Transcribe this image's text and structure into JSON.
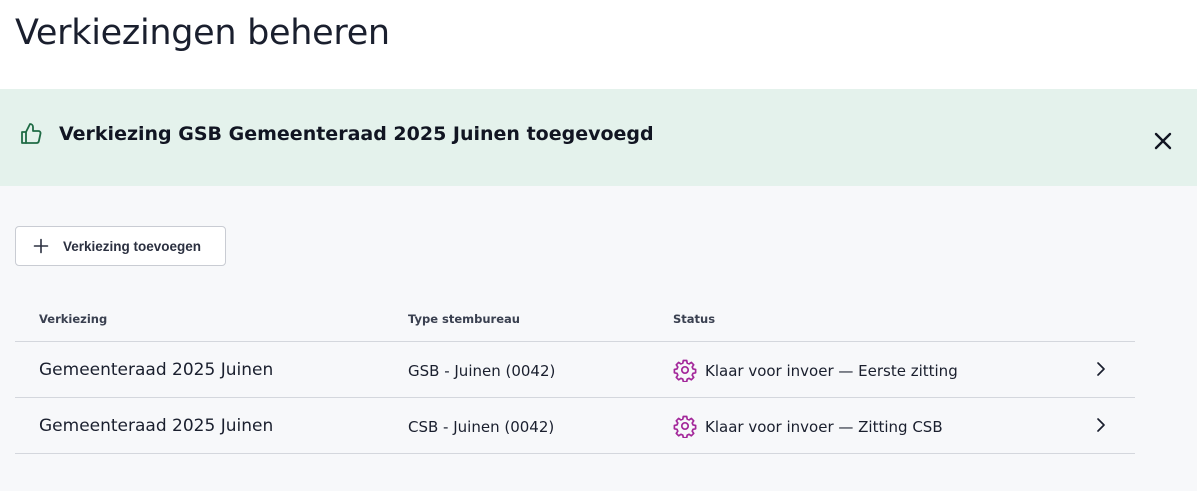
{
  "header": {
    "title": "Verkiezingen beheren"
  },
  "alert": {
    "message": "Verkiezing GSB Gemeenteraad 2025 Juinen toegevoegd",
    "icon": "thumbs-up-icon",
    "close_icon": "close-icon",
    "background_color": "#e4f2ec",
    "icon_color": "#1f6b45"
  },
  "toolbar": {
    "add_label": "Verkiezing toevoegen",
    "add_icon": "plus-icon"
  },
  "table": {
    "columns": [
      "Verkiezing",
      "Type stembureau",
      "Status"
    ],
    "rows": [
      {
        "name": "Gemeenteraad 2025 Juinen",
        "type": "GSB - Juinen (0042)",
        "status": "Klaar voor invoer — Eerste zitting",
        "status_icon": "gear-icon",
        "status_color": "#a3279a"
      },
      {
        "name": "Gemeenteraad 2025 Juinen",
        "type": "CSB - Juinen (0042)",
        "status": "Klaar voor invoer — Zitting CSB",
        "status_icon": "gear-icon",
        "status_color": "#a3279a"
      }
    ]
  }
}
